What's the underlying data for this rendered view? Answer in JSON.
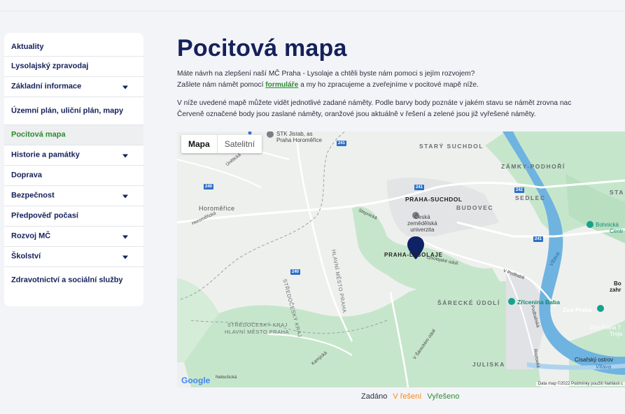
{
  "sidebar": {
    "items": [
      {
        "label": "Aktuality",
        "has_submenu": false
      },
      {
        "label": "Lysolajský zpravodaj",
        "has_submenu": false
      },
      {
        "label": "Základní informace",
        "has_submenu": true
      },
      {
        "label": "Územní plán, uliční plán, mapy",
        "has_submenu": false
      },
      {
        "label": "Pocitová mapa",
        "has_submenu": false,
        "active": true
      },
      {
        "label": "Historie a památky",
        "has_submenu": true
      },
      {
        "label": "Doprava",
        "has_submenu": false
      },
      {
        "label": "Bezpečnost",
        "has_submenu": true
      },
      {
        "label": "Předpověď počasí",
        "has_submenu": false
      },
      {
        "label": "Rozvoj MČ",
        "has_submenu": true
      },
      {
        "label": "Školství",
        "has_submenu": true
      },
      {
        "label": "Zdravotnictví a sociální služby",
        "has_submenu": false
      }
    ]
  },
  "main": {
    "title": "Pocitová mapa",
    "p1_line1": "Máte návrh na zlepšení naší MČ Praha - Lysolaje a chtěli byste nám pomoci s jejím rozvojem?",
    "p1_line2_before": "Zašlete nám námět pomocí ",
    "p1_link": "formuláře",
    "p1_line2_after": " a my ho zpracujeme a zveřejníme v pocitové mapě níže.",
    "p2_line1": "V níže uvedené mapě můžete vidět jednotlivé zadané náměty. Podle barvy body poznáte v jakém stavu se námět zrovna nac",
    "p2_line2": "Červeně označené body jsou zaslané náměty, oranžové jsou aktuálně v řešení a zelené jsou již vyřešené náměty."
  },
  "map": {
    "toggle_map": "Mapa",
    "toggle_sat": "Satelitní",
    "labels": {
      "stary_suchdol": "STARÝ SUCHDOL",
      "zamky_podhori": "ZÁMKY-PODHOŘÍ",
      "praha_suchdol": "PRAHA-SUCHDOL",
      "budovec": "BUDOVEC",
      "sedlec": "SEDLEC",
      "sta": "STA",
      "horomerice": "Horoměřice",
      "praha_lysolaje": "PRAHA-LYSOLAJE",
      "sarecke_udoli": "ŠÁRECKÉ ÚDOLÍ",
      "juliska": "JULISKA",
      "stredocesky_kraj": "STŘEDOČESKÝ KRAJ",
      "hlavni_mesto": "HLAVNÍ MĚSTO PRAHA",
      "vertical_a": "STŘEDOČESKÝ KRAJ",
      "vertical_b": "HLAVNÍ MĚSTO PRAHA",
      "stk_line1": "STK Jistab, as",
      "stk_line2": "Praha Horoměřice",
      "czu_line1": "Česká",
      "czu_line2": "zemědělská",
      "czu_line3": "univerzita",
      "zricenina": "Zřícenina Baba",
      "zoo": "Zoo Praha",
      "bohnicka_line1": "Bohnická",
      "bohnicka_line2": "Centr",
      "zoo_troja_line1": "Zoo Praha T",
      "zoo_troja_line2": "Troja",
      "bo_line1": "Bo",
      "bo_line2": "zahr",
      "cisarsky": "Císařský ostrov",
      "vltava": "Vltava",
      "street_lysolajske": "Lysolajské údolí",
      "street_podbaba": "V Podbabě",
      "street_sarce": "V Šáreckém údolí",
      "street_podbabska": "Podbabská",
      "street_roztocka": "Roztocká",
      "street_unetickа": "Únětická",
      "street_kamycka": "Kamýcká",
      "street_nebusicka": "Nebušická",
      "street_horomericka": "Horoměřická",
      "street_stepnicka": "Stepnická",
      "road_240a": "240",
      "road_240b": "240",
      "road_241a": "241",
      "road_241b": "241",
      "road_242": "242",
      "road_241c": "241"
    },
    "google": "Google",
    "attribution": "Data map ©2022   Podmínky použití   Nahlásit c"
  },
  "legend": {
    "zadano": "Zadáno",
    "v_reseni": "V řešení",
    "vyreseno": "Vyřešeno"
  },
  "colors": {
    "navy": "#14215a",
    "green": "#2d8a2f",
    "orange": "#f08a1a",
    "river": "#4aa3dc",
    "park": "#c6e6cc",
    "pin": "#0e2266"
  }
}
